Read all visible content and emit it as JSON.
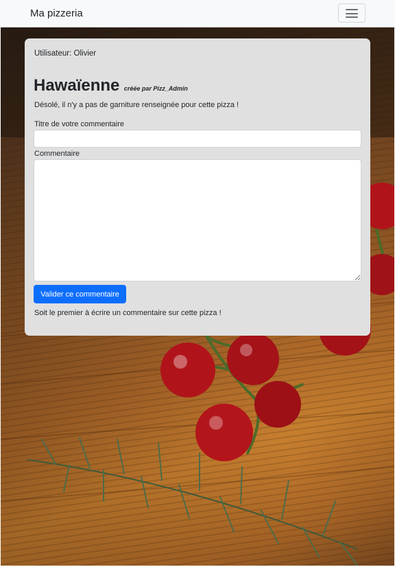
{
  "navbar": {
    "brand": "Ma pizzeria",
    "toggle_icon": "hamburger-menu-icon"
  },
  "card": {
    "user_line": "Utilisateur: Olivier",
    "pizza_name": "Hawaïenne",
    "creator": "créée par Pizz_Admin",
    "no_topping_msg": "Désolé, il n'y a pas de garniture renseignée pour cette pizza !",
    "form": {
      "title_label": "Titre de votre commentaire",
      "title_value": "",
      "comment_label": "Commentaire",
      "comment_value": "",
      "submit_label": "Valider ce commentaire"
    },
    "first_comment_msg": "Soit le premier à écrire un commentaire sur cette pizza !"
  },
  "colors": {
    "navbar_bg": "#f8f9fa",
    "card_bg": "#e0e0e0",
    "primary_button": "#0d6efd"
  }
}
